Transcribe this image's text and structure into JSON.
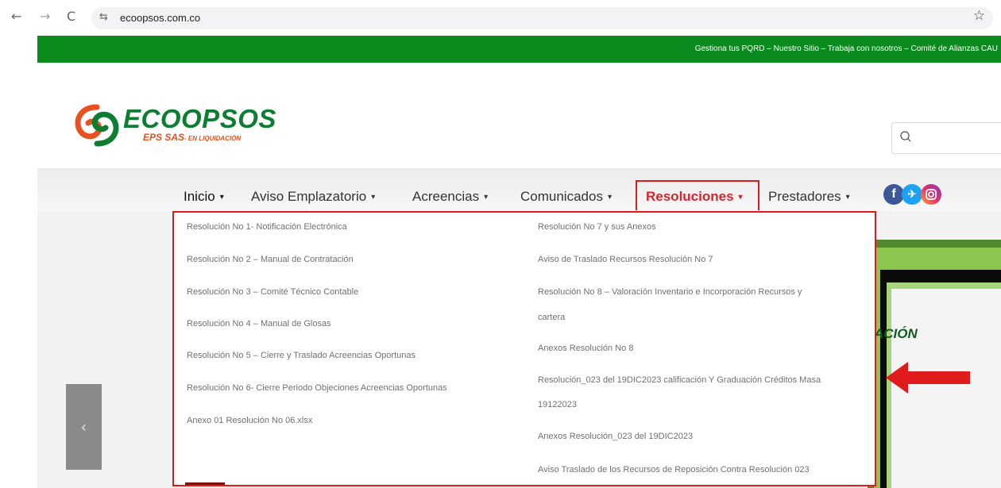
{
  "browser": {
    "back_icon": "back-arrow-icon",
    "forward_icon": "forward-arrow-icon",
    "reload_icon": "reload-icon",
    "url": "ecoopsos.com.co",
    "bookmark_icon": "star-icon"
  },
  "topbar": {
    "links_text": "Gestiona tus PQRD – Nuestro Sitio – Trabaja con nosotros – Comité de Alianzas CAU"
  },
  "logo": {
    "name": "ECOOPSOS",
    "subtitle": "EPS SAS",
    "subtitle_small": "- EN LIQUIDACIÓN"
  },
  "nav": {
    "items": [
      {
        "label": "Inicio"
      },
      {
        "label": "Aviso Emplazatorio"
      },
      {
        "label": "Acreencias"
      },
      {
        "label": "Comunicados"
      },
      {
        "label": "Resoluciones"
      },
      {
        "label": "Prestadores"
      }
    ],
    "caret": "▾"
  },
  "dropdown": {
    "left": [
      "Resolución No 1- Notificación Electrónica",
      "Resolución No 2 – Manual de Contratación",
      "Resolución No 3 – Comité Técnico Contable",
      "Resolución No 4 – Manual de Glosas",
      "Resolución No 5 – Cierre y Traslado Acreencias Oportunas",
      "Resolución No 6- Cierre Periodo Objeciones Acreencias Oportunas",
      "Anexo 01 Resolución No 06.xlsx"
    ],
    "right": [
      "Resolución No 7 y sus Anexos",
      "Aviso de Traslado Recursos Resolución No 7",
      "Resolución No 8 – Valoración Inventario e Incorporación Recursos y",
      "cartera",
      "Anexos Resolución No 8",
      "Resolución_023 del 19DIC2023 calificación Y Graduación Créditos Masa",
      "19122023",
      "Anexos Resolución_023 del 19DIC2023",
      "Aviso Traslado de los Recursos de Reposición Contra Resolución 023"
    ]
  },
  "slider": {
    "prev_label": "‹"
  },
  "banner": {
    "text": "ACIÓN"
  },
  "colors": {
    "green": "#0b8a1e",
    "accent_red": "#e01b1b",
    "logo_green": "#0c7d31",
    "logo_orange": "#e8511f"
  }
}
